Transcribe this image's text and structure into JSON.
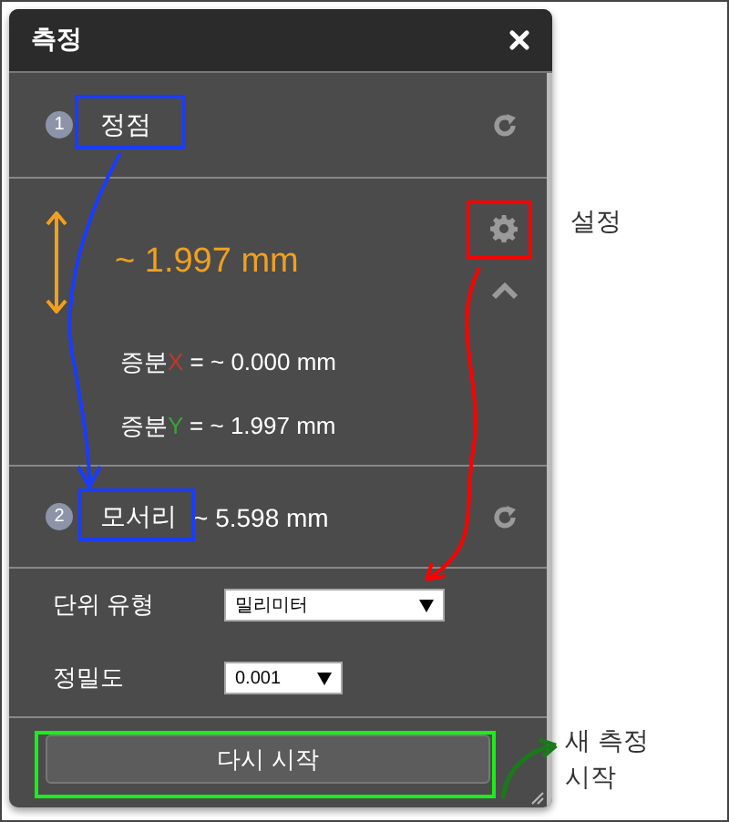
{
  "window": {
    "title": "측정"
  },
  "steps": [
    {
      "number": "1",
      "label": "정점"
    },
    {
      "number": "2",
      "label": "모서리",
      "measurement": "~ 5.598 mm"
    }
  ],
  "result": {
    "value": "~ 1.997 mm",
    "expanded": true,
    "deltas": [
      {
        "prefix": "증분",
        "axis": "X",
        "color": "#c0392b",
        "value": "= ~ 0.000 mm"
      },
      {
        "prefix": "증분",
        "axis": "Y",
        "color": "#3aa33a",
        "value": "= ~ 1.997 mm"
      }
    ]
  },
  "form": [
    {
      "label": "단위 유형",
      "value": "밀리미터",
      "kind": "wide"
    },
    {
      "label": "정밀도",
      "value": "0.001",
      "kind": "narrow"
    }
  ],
  "button": "다시 시작",
  "annotations": [
    {
      "kind": "vertex-to-edge",
      "color": "#1a3cff"
    },
    {
      "kind": "settings",
      "color": "#ff0000",
      "label": "설정"
    },
    {
      "kind": "restart",
      "color": "#1aee1a",
      "label": "새 측정 시작"
    }
  ]
}
